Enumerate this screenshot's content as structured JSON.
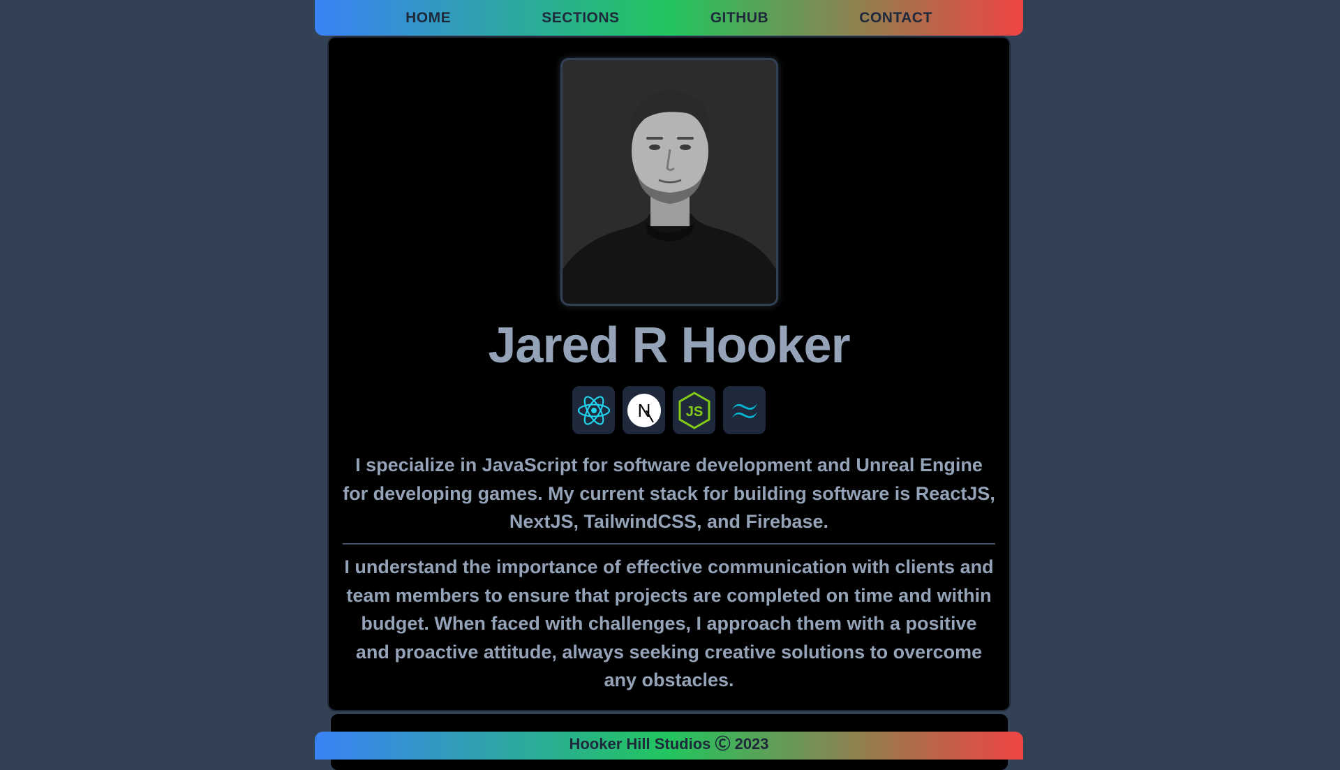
{
  "nav": {
    "items": [
      {
        "label": "HOME"
      },
      {
        "label": "SECTIONS"
      },
      {
        "label": "GITHUB"
      },
      {
        "label": "CONTACT"
      }
    ]
  },
  "profile": {
    "photo": "portrait-photo",
    "name": "Jared R Hooker",
    "stack_icons": [
      "react-icon",
      "nextjs-icon",
      "nodejs-icon",
      "tailwind-icon"
    ],
    "stack_icon_letters": {
      "next": "N",
      "js": "JS"
    }
  },
  "about": {
    "paragraph_1": "I specialize in JavaScript for software development and Unreal Engine for developing games. My current stack for building software is ReactJS, NextJS, TailwindCSS, and Firebase.",
    "paragraph_2": "I understand the importance of effective communication with clients and team members to ensure that projects are completed on time and within budget. When faced with challenges, I approach them with a positive and proactive attitude, always seeking creative solutions to overcome any obstacles."
  },
  "footer": {
    "text": "Hooker Hill Studios Ⓒ 2023"
  },
  "colors": {
    "background": "#334155",
    "card": "#000000",
    "text": "#94a3b8",
    "gradient_start": "#3b82f6",
    "gradient_mid": "#22c55e",
    "gradient_end": "#ef4444"
  }
}
